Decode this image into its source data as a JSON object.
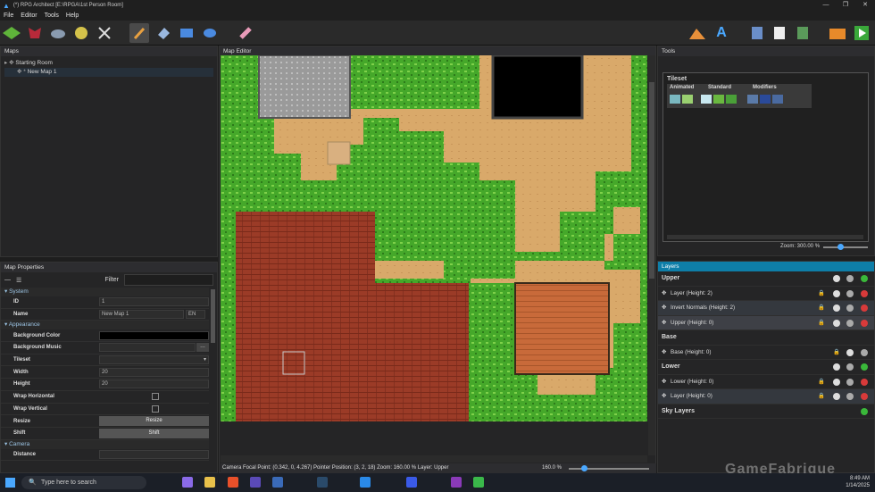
{
  "window": {
    "title": "(*) RPG Architect [E:\\RPGA\\1st Person Room]"
  },
  "menu": [
    "File",
    "Editor",
    "Tools",
    "Help"
  ],
  "toolbar_icons": [
    "terrain-icon",
    "monster-icon",
    "rock-icon",
    "gem-icon",
    "sword-icon",
    "paint-brush-icon",
    "shape-icon",
    "rectangle-icon",
    "ellipse-icon",
    "eraser-icon",
    "mountain-icon",
    "text-icon",
    "script-icon",
    "document-icon",
    "list-icon",
    "folder-icon",
    "play-icon"
  ],
  "maps": {
    "header": "Maps",
    "items": [
      {
        "label": "Starting Room",
        "level": 0
      },
      {
        "label": "New Map 1",
        "level": 1
      }
    ]
  },
  "map_properties": {
    "header": "Map Properties",
    "filter_label": "Filter",
    "sections": {
      "system": "System",
      "appearance": "Appearance",
      "camera": "Camera"
    },
    "id_label": "ID",
    "id_value": "1",
    "name_label": "Name",
    "name_value": "New Map 1",
    "lang": "EN",
    "bg_color_label": "Background Color",
    "bg_music_label": "Background Music",
    "tileset_label": "Tileset",
    "width_label": "Width",
    "width_value": "20",
    "height_label": "Height",
    "height_value": "20",
    "wrap_h_label": "Wrap Horizontal",
    "wrap_v_label": "Wrap Vertical",
    "resize_label": "Resize",
    "resize_button": "Resize",
    "shift_label": "Shift",
    "shift_button": "Shift",
    "distance_label": "Distance"
  },
  "map_editor": {
    "header": "Map Editor",
    "status": "Camera Focal Point: (0.342, 0, 4.267) Pointer Position: (3, 2, 18) Zoom: 160.00 % Layer: Upper",
    "zoom": "160.0 %"
  },
  "tools": {
    "header": "Tools",
    "tileset_title": "Tileset",
    "groups": [
      "Animated",
      "Standard",
      "Modifiers"
    ],
    "zoom": "Zoom: 300.00 %"
  },
  "layers": {
    "header": "Layers",
    "groups": [
      {
        "name": "Upper",
        "items": [
          "Layer (Height: 2)",
          "Invert Normals (Height: 2)",
          "Upper (Height: 0)"
        ]
      },
      {
        "name": "Base",
        "items": [
          "Base (Height: 0)"
        ]
      },
      {
        "name": "Lower",
        "items": [
          "Lower (Height: 0)",
          "Layer (Height: 0)"
        ]
      },
      {
        "name": "Sky Layers",
        "items": []
      }
    ]
  },
  "taskbar": {
    "search": "Type here to search",
    "time": "8:49 AM",
    "date": "1/14/2025"
  },
  "watermark": "GameFabrique",
  "colors": {
    "accent": "#0e7ea8",
    "grass": "#4caf2a",
    "sand": "#d9a96a",
    "brick": "#9b3b27",
    "stone": "#9a9a9a"
  }
}
